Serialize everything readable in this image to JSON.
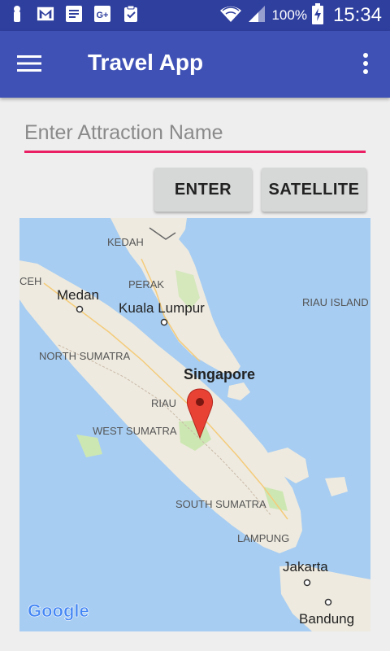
{
  "status_bar": {
    "battery_percent": "100%",
    "time": "15:34",
    "icons": [
      "notification-icon",
      "gmail-icon",
      "docs-icon",
      "gplus-icon",
      "clipboard-check-icon",
      "wifi-icon",
      "cell-signal-icon",
      "battery-charging-icon"
    ]
  },
  "app_bar": {
    "title": "Travel App",
    "menu_icon": "hamburger-menu-icon",
    "overflow_icon": "more-vert-icon"
  },
  "search": {
    "placeholder": "Enter Attraction Name",
    "value": ""
  },
  "buttons": {
    "enter": "ENTER",
    "satellite": "SATELLITE"
  },
  "map": {
    "labels": {
      "kedah": "KEDAH",
      "perak": "PERAK",
      "aceh": "CEH",
      "medan": "Medan",
      "kuala_lumpur": "Kuala Lumpur",
      "riau_islands": "RIAU ISLAND",
      "north_sumatra": "NORTH SUMATRA",
      "singapore": "Singapore",
      "riau": "RIAU",
      "west_sumatra": "WEST SUMATRA",
      "south_sumatra": "SOUTH SUMATRA",
      "lampung": "LAMPUNG",
      "jakarta": "Jakarta",
      "bandung": "Bandung"
    },
    "logo": "Google",
    "marker_icon": "map-pin-icon",
    "colors": {
      "water": "#a7cdf2",
      "land": "#eeeadf",
      "forest": "#cde7b3",
      "marker": "#e84235"
    }
  },
  "colors": {
    "status_bar": "#2f3f9e",
    "app_bar": "#3f51b5",
    "accent": "#e91e63",
    "button": "#d6d7d7"
  }
}
